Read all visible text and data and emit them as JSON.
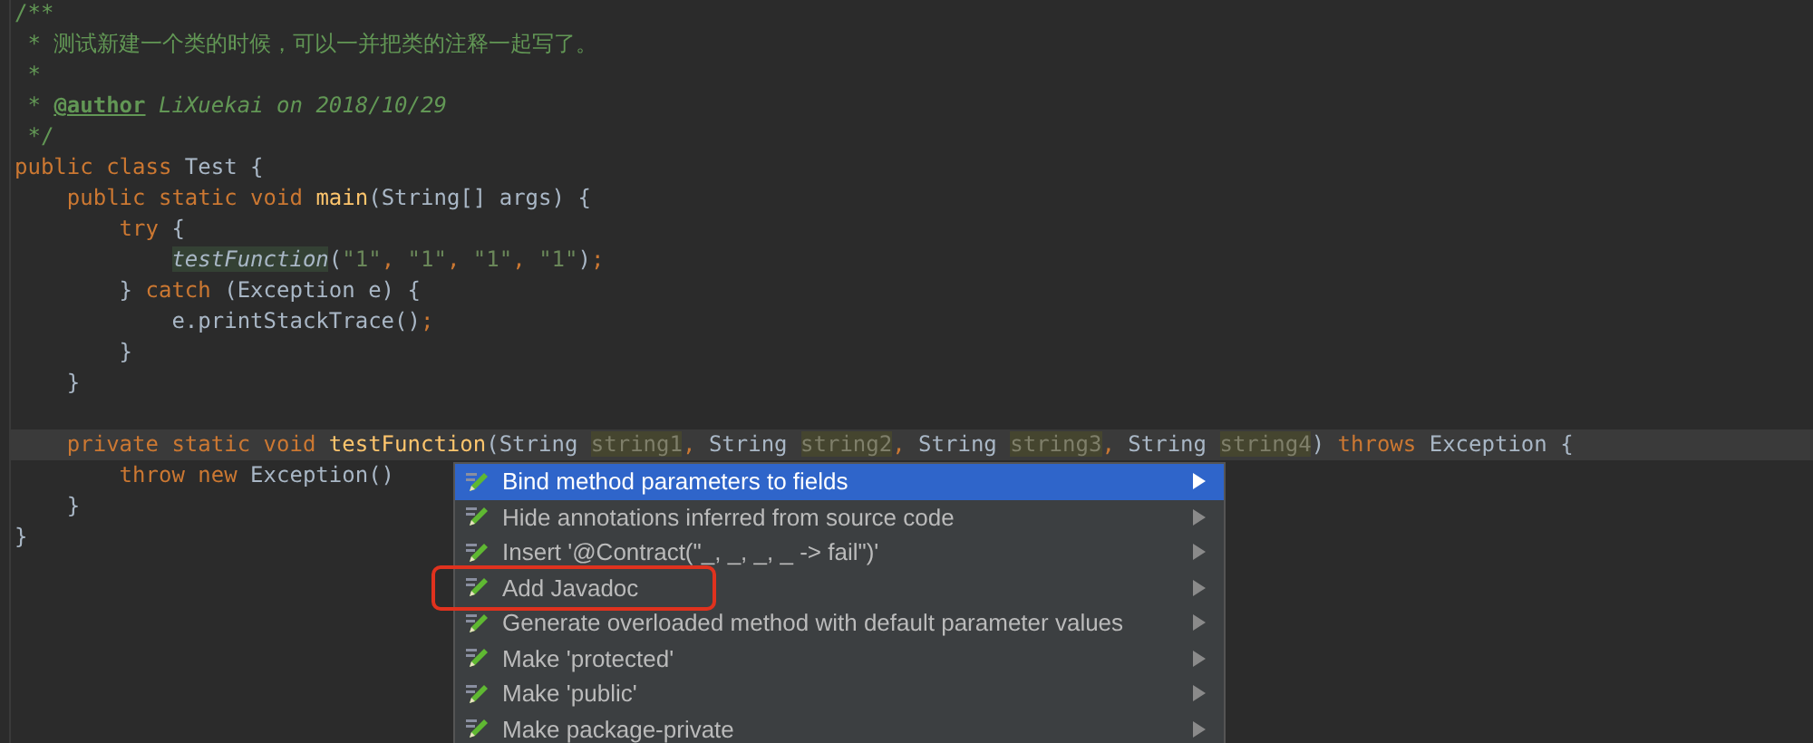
{
  "editor": {
    "lines": [
      {
        "current": false,
        "tokens": [
          {
            "text": "/**",
            "kind": "doc"
          }
        ]
      },
      {
        "current": false,
        "tokens": [
          {
            "text": " * 测试新建一个类的时候，可以一并把类的注释一起写了。",
            "kind": "doc"
          }
        ]
      },
      {
        "current": false,
        "tokens": [
          {
            "text": " *",
            "kind": "doc"
          }
        ]
      },
      {
        "current": false,
        "tokens": [
          {
            "text": " * ",
            "kind": "doc"
          },
          {
            "text": "@author",
            "kind": "doc-tag"
          },
          {
            "text": " LiXuekai on 2018/10/29",
            "kind": "doc-italic"
          }
        ]
      },
      {
        "current": false,
        "tokens": [
          {
            "text": " */",
            "kind": "doc"
          }
        ]
      },
      {
        "current": false,
        "tokens": [
          {
            "text": "public class ",
            "kind": "keyword"
          },
          {
            "text": "Test {",
            "kind": "plain"
          }
        ]
      },
      {
        "current": false,
        "tokens": [
          {
            "text": "    public static void ",
            "kind": "keyword"
          },
          {
            "text": "main",
            "kind": "method"
          },
          {
            "text": "(String[] args) {",
            "kind": "plain"
          }
        ]
      },
      {
        "current": false,
        "tokens": [
          {
            "text": "        try ",
            "kind": "keyword"
          },
          {
            "text": "{",
            "kind": "plain"
          }
        ]
      },
      {
        "current": false,
        "tokens": [
          {
            "text": "            testFunction",
            "kind": "call"
          },
          {
            "text": "(",
            "kind": "plain"
          },
          {
            "text": "\"1\"",
            "kind": "string"
          },
          {
            "text": ", ",
            "kind": "keyword"
          },
          {
            "text": "\"1\"",
            "kind": "string"
          },
          {
            "text": ", ",
            "kind": "keyword"
          },
          {
            "text": "\"1\"",
            "kind": "string"
          },
          {
            "text": ", ",
            "kind": "keyword"
          },
          {
            "text": "\"1\"",
            "kind": "string"
          },
          {
            "text": ")",
            "kind": "plain"
          },
          {
            "text": ";",
            "kind": "keyword"
          }
        ]
      },
      {
        "current": false,
        "tokens": [
          {
            "text": "        } ",
            "kind": "plain"
          },
          {
            "text": "catch ",
            "kind": "keyword"
          },
          {
            "text": "(Exception e) {",
            "kind": "plain"
          }
        ]
      },
      {
        "current": false,
        "tokens": [
          {
            "text": "            e.printStackTrace()",
            "kind": "plain"
          },
          {
            "text": ";",
            "kind": "keyword"
          }
        ]
      },
      {
        "current": false,
        "tokens": [
          {
            "text": "        }",
            "kind": "plain"
          }
        ]
      },
      {
        "current": false,
        "tokens": [
          {
            "text": "    }",
            "kind": "plain"
          }
        ]
      },
      {
        "current": false
      },
      {
        "current": true,
        "tokens": [
          {
            "text": "    private static void ",
            "kind": "keyword"
          },
          {
            "text": "testFunction",
            "kind": "method"
          },
          {
            "text": "(String ",
            "kind": "plain"
          },
          {
            "text": "string1",
            "kind": "unused"
          },
          {
            "text": ", ",
            "kind": "keyword"
          },
          {
            "text": "String ",
            "kind": "plain"
          },
          {
            "text": "string2",
            "kind": "unused"
          },
          {
            "text": ", ",
            "kind": "keyword"
          },
          {
            "text": "String ",
            "kind": "plain"
          },
          {
            "text": "string3",
            "kind": "unused"
          },
          {
            "text": ", ",
            "kind": "keyword"
          },
          {
            "text": "String ",
            "kind": "plain"
          },
          {
            "text": "string4",
            "kind": "unused"
          },
          {
            "text": ") ",
            "kind": "plain"
          },
          {
            "text": "throws ",
            "kind": "keyword"
          },
          {
            "text": "Exception {",
            "kind": "plain"
          }
        ]
      },
      {
        "current": false,
        "tokens": [
          {
            "text": "        throw new ",
            "kind": "keyword"
          },
          {
            "text": "Exception()",
            "kind": "plain"
          }
        ]
      },
      {
        "current": false,
        "tokens": [
          {
            "text": "    }",
            "kind": "plain"
          }
        ]
      },
      {
        "current": false,
        "tokens": [
          {
            "text": "}",
            "kind": "plain"
          }
        ]
      }
    ]
  },
  "menu": {
    "items": [
      {
        "label": "Bind method parameters to fields",
        "selected": true,
        "highlighted": false
      },
      {
        "label": "Hide annotations inferred from source code",
        "selected": false,
        "highlighted": false
      },
      {
        "label": "Insert '@Contract(\"_, _, _, _ -> fail\")'",
        "selected": false,
        "highlighted": false
      },
      {
        "label": "Add Javadoc",
        "selected": false,
        "highlighted": true
      },
      {
        "label": "Generate overloaded method with default parameter values",
        "selected": false,
        "highlighted": false
      },
      {
        "label": "Make 'protected'",
        "selected": false,
        "highlighted": false
      },
      {
        "label": "Make 'public'",
        "selected": false,
        "highlighted": false
      },
      {
        "label": "Make package-private",
        "selected": false,
        "highlighted": false
      }
    ]
  }
}
